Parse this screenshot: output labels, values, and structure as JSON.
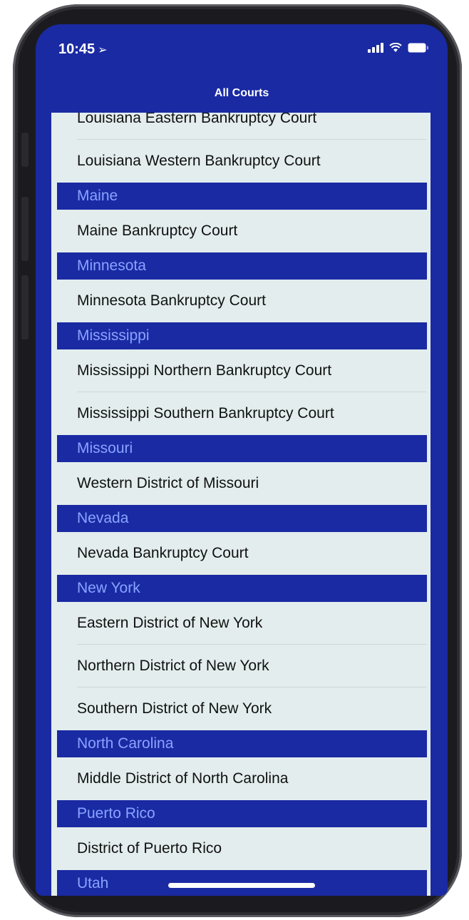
{
  "status_bar": {
    "time": "10:45",
    "location_icon": "location-arrow-icon",
    "signal_icon": "cellular-signal-icon",
    "wifi_icon": "wifi-icon",
    "battery_icon": "battery-icon"
  },
  "nav": {
    "title": "All Courts"
  },
  "colors": {
    "brand": "#1a2aa3",
    "header_text": "#8aa3ff",
    "list_bg": "#e3eded"
  },
  "list": {
    "top_rows": [
      "Louisiana Eastern Bankruptcy Court",
      "Louisiana Western Bankruptcy Court"
    ],
    "sections": [
      {
        "header": "Maine",
        "rows": [
          "Maine Bankruptcy Court"
        ]
      },
      {
        "header": "Minnesota",
        "rows": [
          "Minnesota Bankruptcy Court"
        ]
      },
      {
        "header": "Mississippi",
        "rows": [
          "Mississippi Northern Bankruptcy Court",
          "Mississippi Southern Bankruptcy Court"
        ]
      },
      {
        "header": "Missouri",
        "rows": [
          "Western District of Missouri"
        ]
      },
      {
        "header": "Nevada",
        "rows": [
          "Nevada Bankruptcy Court"
        ]
      },
      {
        "header": "New York",
        "rows": [
          "Eastern District of New York",
          "Northern District of New York",
          "Southern District of New York"
        ]
      },
      {
        "header": "North Carolina",
        "rows": [
          "Middle District of North Carolina"
        ]
      },
      {
        "header": "Puerto Rico",
        "rows": [
          "District of Puerto Rico"
        ]
      },
      {
        "header": "Utah",
        "rows": []
      }
    ]
  }
}
